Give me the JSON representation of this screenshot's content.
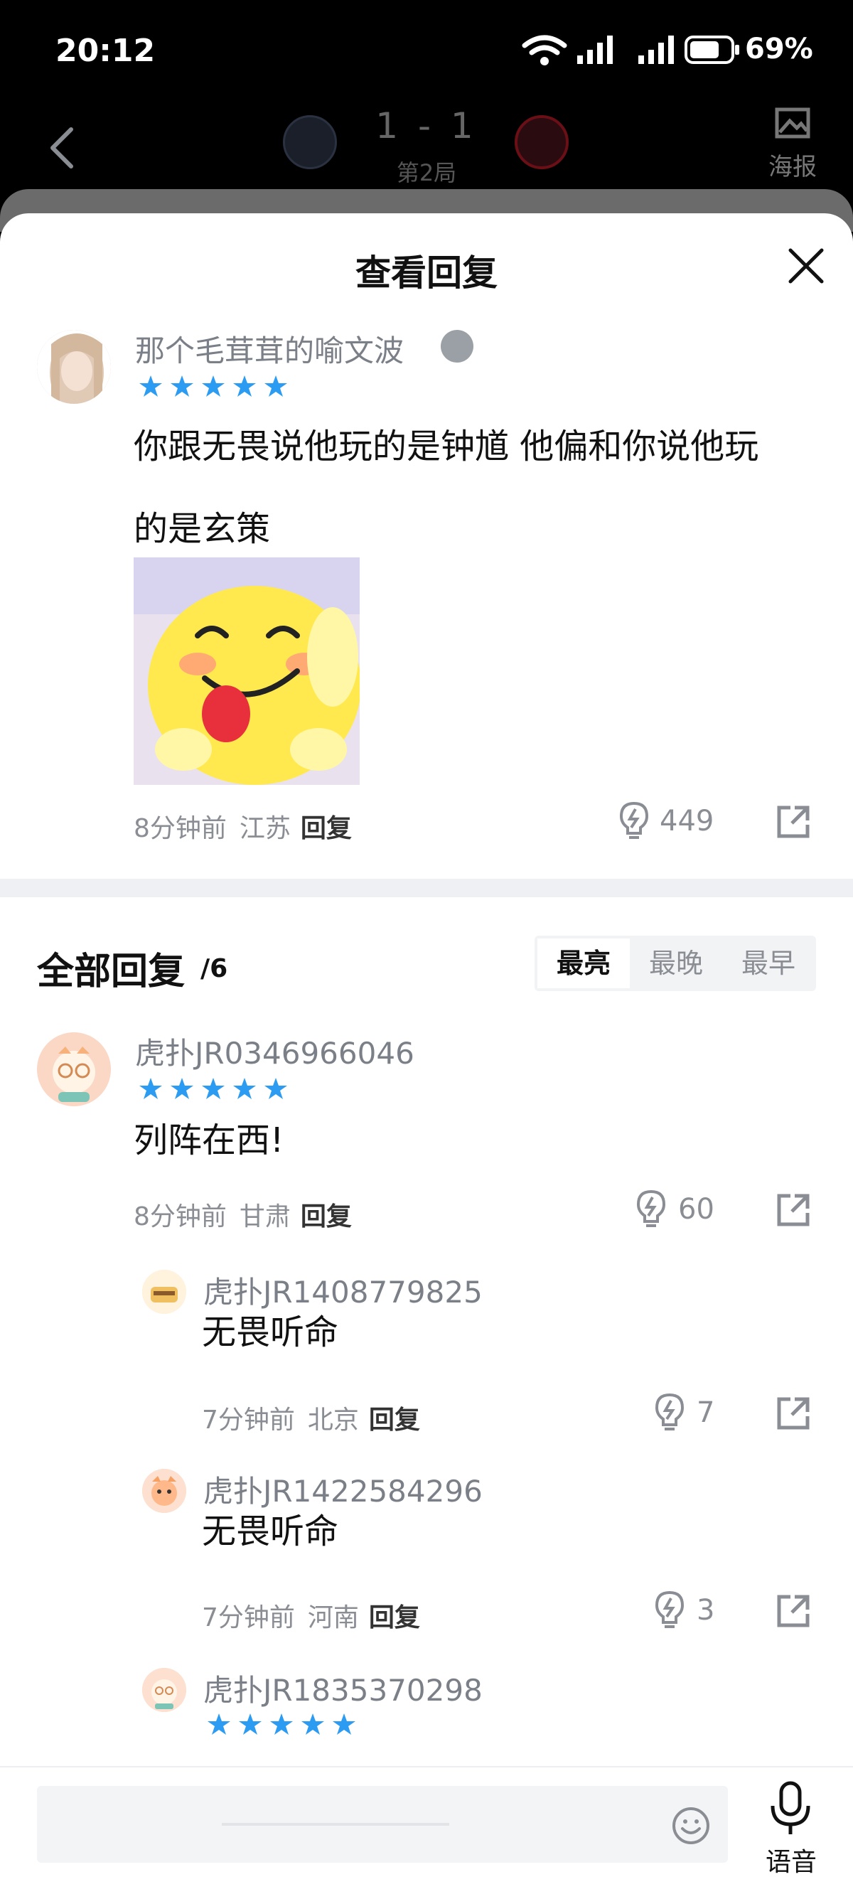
{
  "status_bar": {
    "time": "20:12",
    "battery": "69%"
  },
  "match": {
    "score": "1 - 1",
    "round": "第2局",
    "poster_label": "海报"
  },
  "sheet": {
    "title": "查看回复"
  },
  "main_comment": {
    "username": "那个毛茸茸的喻文波",
    "text_line1": "你跟无畏说他玩的是钟馗 他偏和你说他玩",
    "text_line2": "的是玄策",
    "time": "8分钟前",
    "location": "江苏",
    "reply_label": "回复",
    "likes": "449"
  },
  "replies_section": {
    "title": "全部回复",
    "count": "/6",
    "sort_options": [
      "最亮",
      "最晚",
      "最早"
    ]
  },
  "replies": [
    {
      "username": "虎扑JR0346966046",
      "text": "列阵在西!",
      "time": "8分钟前",
      "location": "甘肃",
      "reply_label": "回复",
      "likes": "60"
    },
    {
      "username": "虎扑JR1408779825",
      "text": "无畏听命",
      "time": "7分钟前",
      "location": "北京",
      "reply_label": "回复",
      "likes": "7"
    },
    {
      "username": "虎扑JR1422584296",
      "text": "无畏听命",
      "time": "7分钟前",
      "location": "河南",
      "reply_label": "回复",
      "likes": "3"
    },
    {
      "username": "虎扑JR1835370298"
    }
  ],
  "bottom_bar": {
    "voice_label": "语音"
  },
  "colors": {
    "star": "#2b9cf2",
    "accent_text": "#111111",
    "meta": "#8a8d93"
  }
}
